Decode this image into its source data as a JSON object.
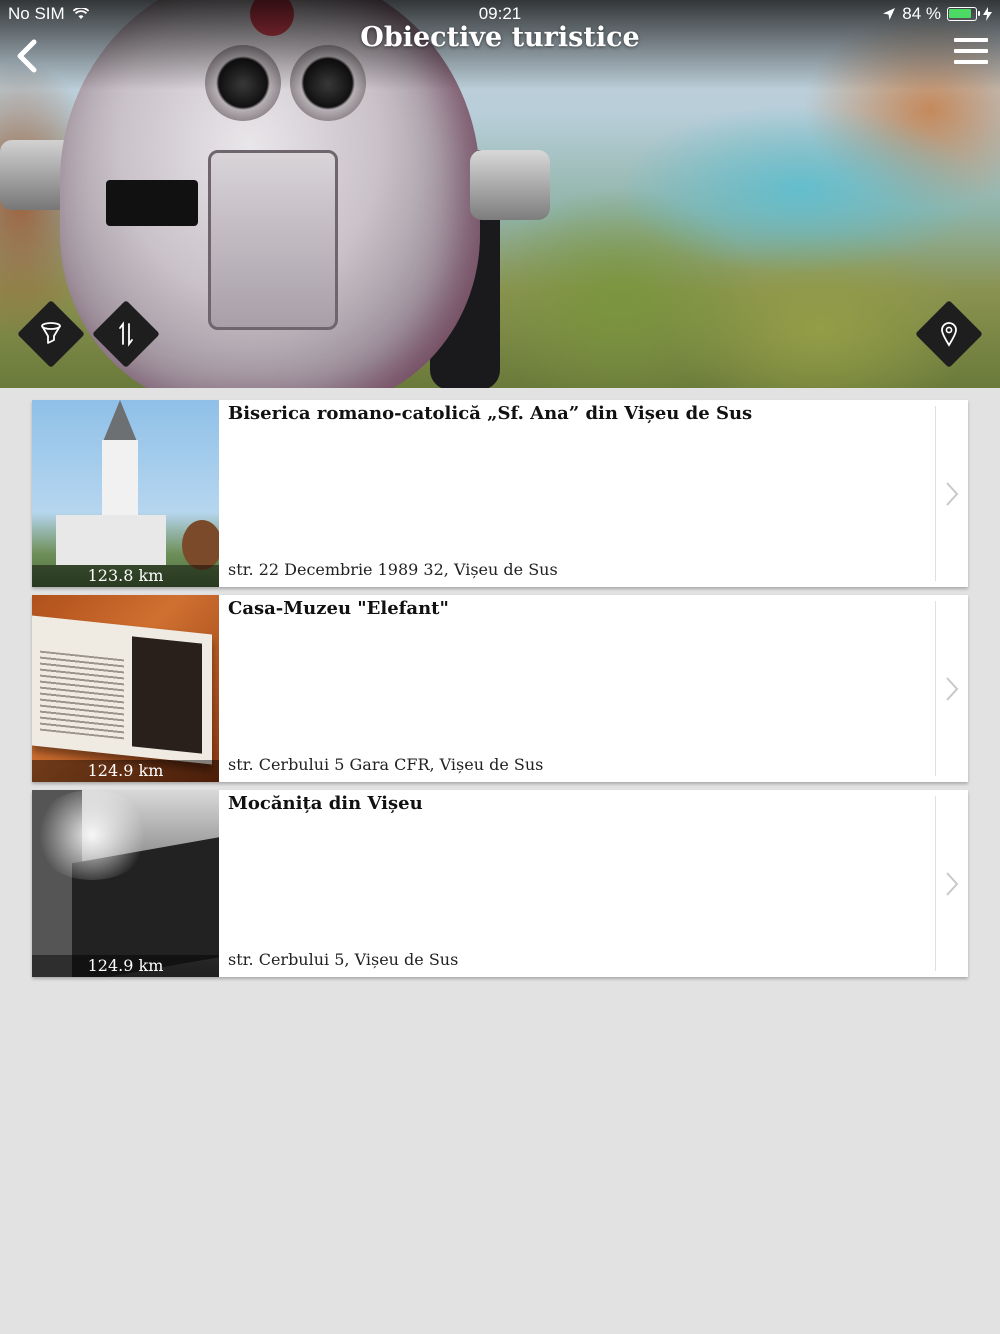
{
  "status_bar": {
    "carrier": "No SIM",
    "time": "09:21",
    "battery_percent": "84 %",
    "battery_level": 0.84
  },
  "nav": {
    "title": "Obiective turistice",
    "back_icon": "chevron-left-icon",
    "menu_icon": "hamburger-menu-icon"
  },
  "hero_actions": {
    "filter_icon": "filter-funnel-icon",
    "sort_icon": "sort-arrows-icon",
    "map_icon": "map-pin-icon"
  },
  "colors": {
    "background": "#e2e2e2",
    "card": "#ffffff",
    "diamond": "#1e1e1e",
    "battery": "#4cd964"
  },
  "attractions": [
    {
      "title": "Biserica romano-catolică „Sf. Ana” din Vișeu de Sus",
      "address": "str. 22 Decembrie 1989 32, Vișeu de Sus",
      "distance": "123.8 km"
    },
    {
      "title": "Casa-Muzeu \"Elefant\"",
      "address": "str. Cerbului 5 Gara CFR, Vișeu de Sus",
      "distance": "124.9 km"
    },
    {
      "title": "Mocănița din Vișeu",
      "address": "str. Cerbului 5, Vișeu de Sus",
      "distance": "124.9 km"
    }
  ]
}
